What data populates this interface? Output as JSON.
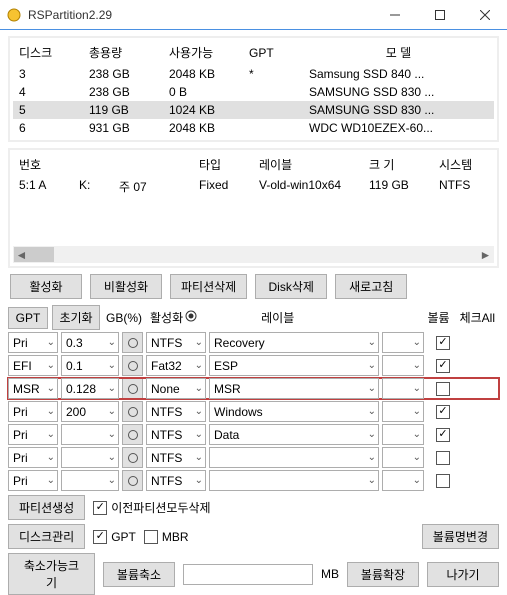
{
  "title": "RSPartition2.29",
  "disk_table": {
    "headers": [
      "디스크",
      "총용량",
      "사용가능",
      "GPT",
      "모  델"
    ],
    "rows": [
      {
        "disk": "3",
        "total": "238 GB",
        "free": "2048 KB",
        "gpt": "*",
        "model": "Samsung SSD 840 ...",
        "sel": false
      },
      {
        "disk": "4",
        "total": "238 GB",
        "free": "0 B",
        "gpt": "",
        "model": "SAMSUNG SSD 830 ...",
        "sel": false
      },
      {
        "disk": "5",
        "total": "119 GB",
        "free": "1024 KB",
        "gpt": "",
        "model": "SAMSUNG SSD 830 ...",
        "sel": true
      },
      {
        "disk": "6",
        "total": "931 GB",
        "free": "2048 KB",
        "gpt": "",
        "model": "WDC WD10EZEX-60...",
        "sel": false
      }
    ]
  },
  "part_table": {
    "headers": [
      "번호",
      "",
      "",
      "타입",
      "레이블",
      "크 기",
      "시스템"
    ],
    "row": {
      "num": "5:1  A",
      "drv": "K:",
      "pri": "주      07",
      "type": "Fixed",
      "label": "V-old-win10x64",
      "size": "119 GB",
      "fs": "NTFS"
    }
  },
  "toolbar": {
    "activate": "활성화",
    "deactivate": "비활성화",
    "delpart": "파티션삭제",
    "deldisk": "Disk삭제",
    "refresh": "새로고침"
  },
  "grid": {
    "btn_gpt": "GPT",
    "btn_init": "초기화",
    "hdr_gb": "GB(%)",
    "hdr_act": "활성화",
    "hdr_label": "레이블",
    "hdr_vol": "볼륨",
    "hdr_chk": "체크All",
    "rows": [
      {
        "type": "Pri",
        "gb": "0.3",
        "act": false,
        "fs": "NTFS",
        "label": "Recovery",
        "vol": "",
        "chk": true,
        "hl": false
      },
      {
        "type": "EFI",
        "gb": "0.1",
        "act": false,
        "fs": "Fat32",
        "label": "ESP",
        "vol": "",
        "chk": true,
        "hl": false
      },
      {
        "type": "MSR",
        "gb": "0.128",
        "act": false,
        "fs": "None",
        "label": "MSR",
        "vol": "",
        "chk": false,
        "hl": true
      },
      {
        "type": "Pri",
        "gb": "200",
        "act": false,
        "fs": "NTFS",
        "label": "Windows",
        "vol": "",
        "chk": true,
        "hl": false
      },
      {
        "type": "Pri",
        "gb": "",
        "act": false,
        "fs": "NTFS",
        "label": "Data",
        "vol": "",
        "chk": true,
        "hl": false
      },
      {
        "type": "Pri",
        "gb": "",
        "act": false,
        "fs": "NTFS",
        "label": "",
        "vol": "",
        "chk": false,
        "hl": false
      },
      {
        "type": "Pri",
        "gb": "",
        "act": false,
        "fs": "NTFS",
        "label": "",
        "vol": "",
        "chk": false,
        "hl": false
      }
    ]
  },
  "bottom": {
    "create": "파티션생성",
    "del_prev": "이전파티션모두삭제",
    "diskmgmt": "디스크관리",
    "gpt": "GPT",
    "mbr": "MBR",
    "rename": "볼륨명변경",
    "shrink": "축소가능크기",
    "reduce": "볼륨축소",
    "mb": "MB",
    "expand": "볼륨확장",
    "exit": "나가기"
  }
}
